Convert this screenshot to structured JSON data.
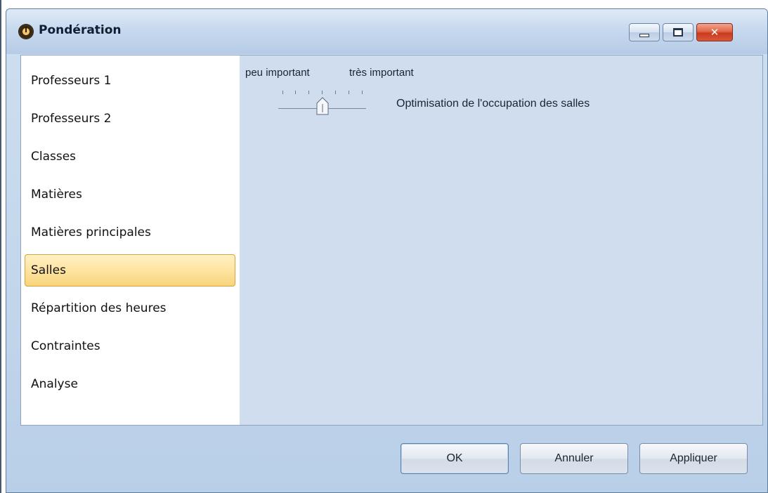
{
  "window": {
    "title": "Pondération",
    "icon": "clock-icon",
    "controls": {
      "minimize": "minimize-icon",
      "maximize": "maximize-icon",
      "close": "close-icon"
    }
  },
  "sidebar": {
    "items": [
      {
        "label": "Professeurs 1",
        "selected": false
      },
      {
        "label": "Professeurs 2",
        "selected": false
      },
      {
        "label": "Classes",
        "selected": false
      },
      {
        "label": "Matières",
        "selected": false
      },
      {
        "label": "Matières principales",
        "selected": false
      },
      {
        "label": "Salles",
        "selected": true
      },
      {
        "label": "Répartition des heures",
        "selected": false
      },
      {
        "label": "Contraintes",
        "selected": false
      },
      {
        "label": "Analyse",
        "selected": false
      }
    ]
  },
  "main": {
    "scale_low_label": "peu important",
    "scale_high_label": "très important",
    "settings": [
      {
        "label": "Optimisation de l'occupation des salles",
        "level": 0.5
      }
    ]
  },
  "footer": {
    "ok_label": "OK",
    "cancel_label": "Annuler",
    "apply_label": "Appliquer"
  },
  "colors": {
    "selected_background": "#fde199",
    "selected_border": "#d9a23b",
    "panel_background": "#cfddee",
    "close_button": "#d9583a"
  }
}
